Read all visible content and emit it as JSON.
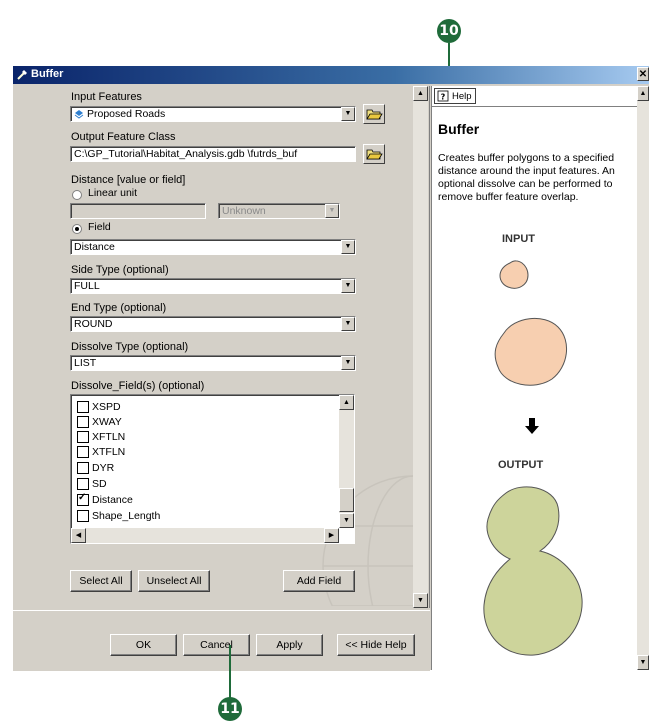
{
  "callouts": {
    "top": "10",
    "bottom": "11"
  },
  "window": {
    "title": "Buffer"
  },
  "form": {
    "input_features": {
      "label": "Input Features",
      "value": "Proposed Roads"
    },
    "output_feature_class": {
      "label": "Output Feature Class",
      "value": "C:\\GP_Tutorial\\Habitat_Analysis.gdb \\futrds_buf"
    },
    "distance": {
      "label": "Distance [value or field]",
      "linear_unit_label": "Linear unit",
      "linear_unit_value": "",
      "unit_value": "Unknown",
      "field_label": "Field",
      "field_value": "Distance",
      "selected": "Field"
    },
    "side_type": {
      "label": "Side Type (optional)",
      "value": "FULL"
    },
    "end_type": {
      "label": "End Type (optional)",
      "value": "ROUND"
    },
    "dissolve_type": {
      "label": "Dissolve Type (optional)",
      "value": "LIST"
    },
    "dissolve_fields": {
      "label": "Dissolve_Field(s) (optional)",
      "items": [
        {
          "name": "XSPD",
          "checked": false
        },
        {
          "name": "XWAY",
          "checked": false
        },
        {
          "name": "XFTLN",
          "checked": false
        },
        {
          "name": "XTFLN",
          "checked": false
        },
        {
          "name": "DYR",
          "checked": false
        },
        {
          "name": "SD",
          "checked": false
        },
        {
          "name": "Distance",
          "checked": true
        },
        {
          "name": "Shape_Length",
          "checked": false
        }
      ]
    },
    "buttons": {
      "select_all": "Select All",
      "unselect_all": "Unselect All",
      "add_field": "Add Field"
    }
  },
  "footer": {
    "ok": "OK",
    "cancel": "Cancel",
    "apply": "Apply",
    "hide_help": "<< Hide Help"
  },
  "help": {
    "tab_label": "Help",
    "title": "Buffer",
    "description": "Creates buffer polygons to a specified distance around the input features. An optional dissolve can be performed to remove buffer feature overlap.",
    "input_label": "INPUT",
    "output_label": "OUTPUT"
  },
  "colors": {
    "input_fill": "#f7cfb0",
    "output_fill": "#cdd49b",
    "callout": "#1f6b3a"
  }
}
